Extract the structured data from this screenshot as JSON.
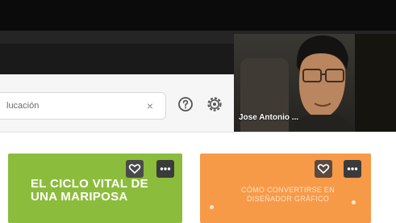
{
  "search": {
    "value": "lucación",
    "clear_glyph": "×"
  },
  "toolbar": {
    "help_icon": "help-circle-icon",
    "settings_icon": "gear-icon"
  },
  "video": {
    "participant_name": "Jose Antonio ..."
  },
  "cards": [
    {
      "title": "EL CICLO VITAL DE UNA MARIPOSA",
      "color": "#8cbc3c",
      "icons": [
        "heart-icon",
        "more-icon"
      ]
    },
    {
      "title": "CÓMO CONVERTIRSE EN DISEÑADOR GRÁFICO",
      "color": "#f79a48",
      "icons": [
        "heart-icon",
        "more-icon"
      ]
    }
  ]
}
